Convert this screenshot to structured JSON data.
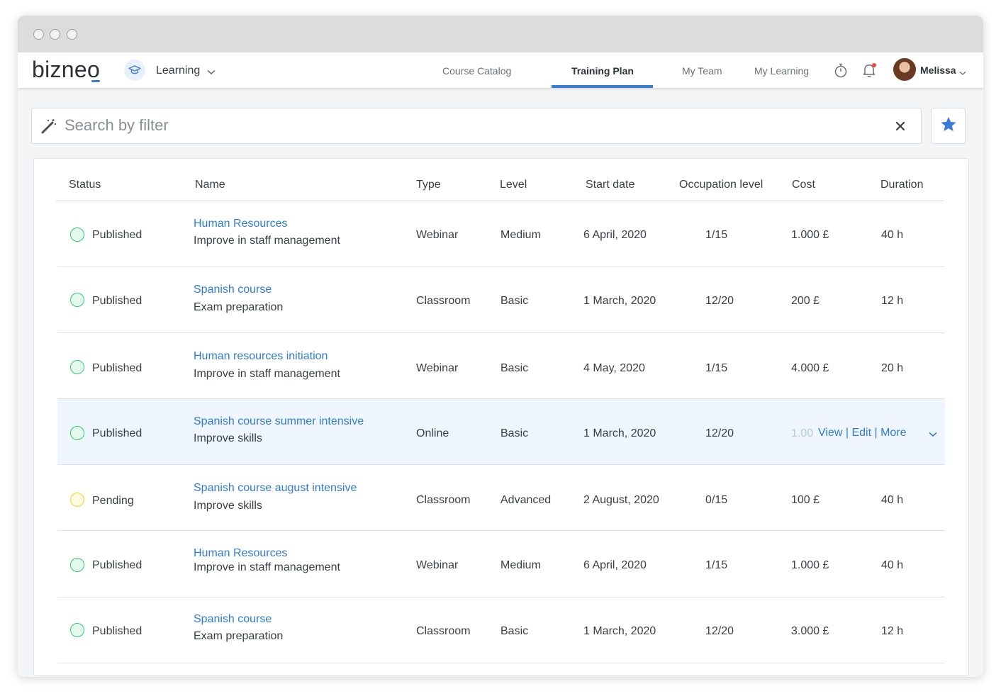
{
  "navbar": {
    "logo": "bizneo",
    "module": "Learning",
    "links": [
      "Course Catalog",
      "Training Plan",
      "My Team",
      "My Learning"
    ],
    "active_link": "Training Plan",
    "user_name": "Melissa"
  },
  "search": {
    "placeholder": "Search by filter",
    "value": ""
  },
  "table": {
    "headers": [
      "Status",
      "Name",
      "Type",
      "Level",
      "Start date",
      "Occupation level",
      "Cost",
      "Duration"
    ],
    "rows": [
      {
        "status": "Published",
        "title": "Human Resources",
        "subtitle": "Improve in staff management",
        "type": "Webinar",
        "level": "Medium",
        "start": "6 April, 2020",
        "occupation": "1/15",
        "cost": "1.000 £",
        "duration": "40 h"
      },
      {
        "status": "Published",
        "title": "Spanish course",
        "subtitle": "Exam preparation",
        "type": "Classroom",
        "level": "Basic",
        "start": "1 March, 2020",
        "occupation": "12/20",
        "cost": "200 £",
        "duration": "12 h"
      },
      {
        "status": "Published",
        "title": "Human resources initiation",
        "subtitle": "Improve in staff management",
        "type": "Webinar",
        "level": "Basic",
        "start": "4 May, 2020",
        "occupation": "1/15",
        "cost": "4.000 £",
        "duration": "20 h"
      },
      {
        "status": "Published",
        "title": "Spanish course summer intensive",
        "subtitle": "Improve skills",
        "type": "Online",
        "level": "Basic",
        "start": "1 March, 2020",
        "occupation": "12/20",
        "cost": "1.00",
        "duration": ""
      },
      {
        "status": "Pending",
        "title": "Spanish course august intensive",
        "subtitle": "Improve skills",
        "type": "Classroom",
        "level": "Advanced",
        "start": "2 August, 2020",
        "occupation": "0/15",
        "cost": "100 £",
        "duration": "40 h"
      },
      {
        "status": "Published",
        "title": "Human Resources",
        "subtitle": "Improve in staff management",
        "type": "Webinar",
        "level": "Medium",
        "start": "6 April, 2020",
        "occupation": "1/15",
        "cost": "1.000 £",
        "duration": "40 h"
      },
      {
        "status": "Published",
        "title": "Spanish course",
        "subtitle": "Exam preparation",
        "type": "Classroom",
        "level": "Basic",
        "start": "1 March, 2020",
        "occupation": "12/20",
        "cost": "3.000 £",
        "duration": "12 h"
      }
    ],
    "row_actions": {
      "view": "View",
      "edit": "Edit",
      "more": "More",
      "separator": "|"
    }
  },
  "colors": {
    "accent": "#3a7bd5",
    "link": "#2f7cd3",
    "published": "#2ecc71",
    "pending": "#e6d32a",
    "highlight_row": "#eef5fd"
  },
  "icons": {
    "module": "graduation-cap-icon",
    "timer": "stopwatch-icon",
    "notifications": "bell-icon",
    "search": "magic-wand-icon",
    "clear": "close-icon",
    "favorite": "star-icon"
  }
}
